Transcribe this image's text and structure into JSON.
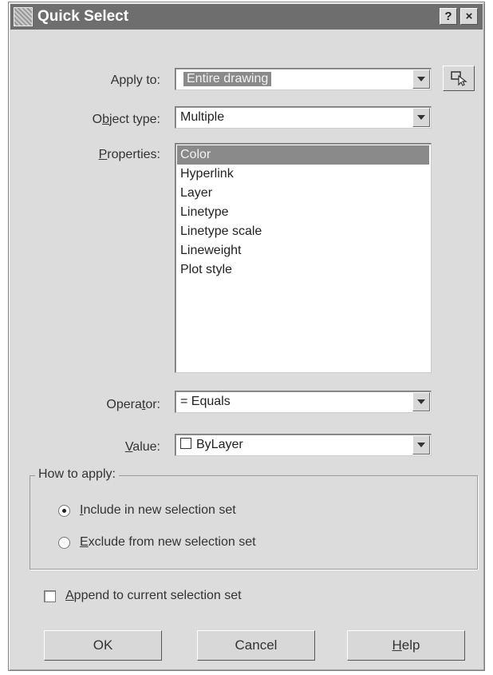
{
  "window": {
    "title": "Quick Select",
    "help_glyph": "?",
    "close_glyph": "×"
  },
  "fields": {
    "apply_to": {
      "label": "Apply to:",
      "value": "Entire drawing"
    },
    "object_type": {
      "label": "Object type:",
      "value": "Multiple"
    },
    "properties": {
      "label": "Properties:",
      "items": [
        "Color",
        "Hyperlink",
        "Layer",
        "Linetype",
        "Linetype scale",
        "Lineweight",
        "Plot style"
      ],
      "selected_index": 0
    },
    "operator": {
      "label": "Operator:",
      "value": "= Equals"
    },
    "value": {
      "label": "Value:",
      "value": "ByLayer"
    }
  },
  "how_to_apply": {
    "title": "How to apply:",
    "include": {
      "label": "Include in new selection set",
      "checked": true
    },
    "exclude": {
      "label": "Exclude from new selection set",
      "checked": false
    }
  },
  "append": {
    "label": "Append to current selection set",
    "checked": false
  },
  "buttons": {
    "ok": "OK",
    "cancel": "Cancel",
    "help": "Help"
  },
  "icons": {
    "select_objects": "select-objects-icon",
    "window": "app-icon"
  }
}
